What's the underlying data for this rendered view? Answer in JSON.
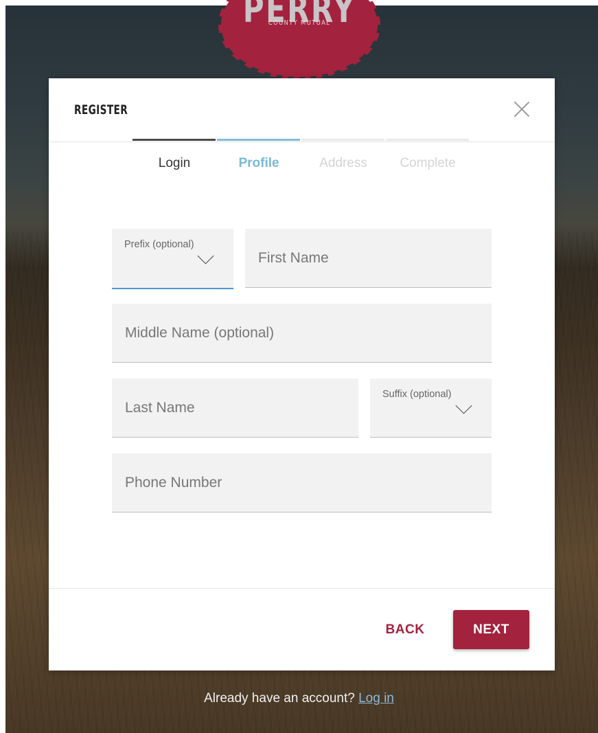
{
  "logo": {
    "name": "PERRY",
    "subtitle": "COUNTY MUTUAL"
  },
  "modal": {
    "title": "REGISTER",
    "close_icon": "close-icon"
  },
  "steps": [
    {
      "label": "Login",
      "state": "done"
    },
    {
      "label": "Profile",
      "state": "active"
    },
    {
      "label": "Address",
      "state": "todo"
    },
    {
      "label": "Complete",
      "state": "todo"
    }
  ],
  "form": {
    "prefix": {
      "label": "Prefix (optional)",
      "value": ""
    },
    "first_name": {
      "placeholder": "First Name",
      "value": ""
    },
    "middle_name": {
      "placeholder": "Middle Name (optional)",
      "value": ""
    },
    "last_name": {
      "placeholder": "Last Name",
      "value": ""
    },
    "suffix": {
      "label": "Suffix (optional)",
      "value": ""
    },
    "phone": {
      "placeholder": "Phone Number",
      "value": ""
    }
  },
  "actions": {
    "back_label": "BACK",
    "next_label": "NEXT"
  },
  "footer": {
    "prompt": "Already have an account?",
    "login_link": "Log in"
  },
  "colors": {
    "brand": "#a3223e",
    "active_step": "#79b9d6",
    "focus_underline": "#4b98d6",
    "link": "#8fb9d9"
  }
}
